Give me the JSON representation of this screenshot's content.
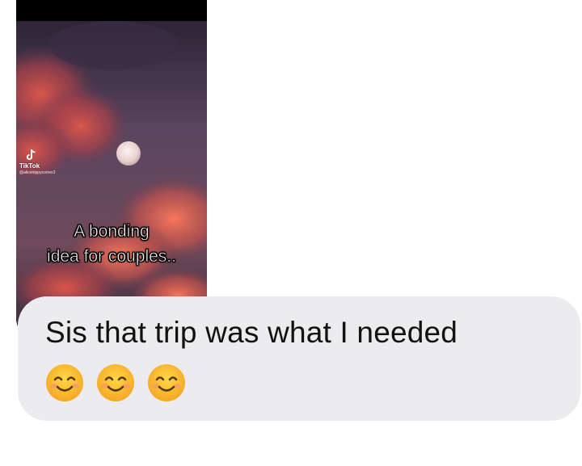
{
  "video_preview": {
    "watermark": {
      "brand": "TikTok",
      "handle": "@alicetrippycorner2",
      "icon": "tiktok-logo-icon"
    },
    "caption_lines": [
      "A bonding",
      "idea for couples.."
    ]
  },
  "message": {
    "text": "Sis that trip was what I needed",
    "emojis": [
      "smiling-face-icon",
      "smiling-face-icon",
      "smiling-face-icon"
    ]
  },
  "colors": {
    "bubble": "#ececee",
    "text": "#111111",
    "background": "#ffffff"
  }
}
